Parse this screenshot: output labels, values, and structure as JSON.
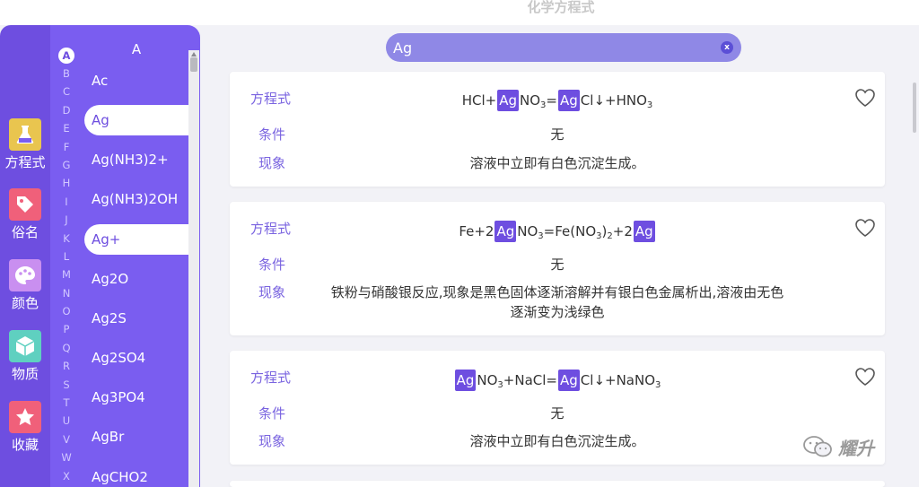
{
  "app": {
    "title": "化学方程式"
  },
  "categories": [
    {
      "label": "方程式",
      "icon": "flask-icon",
      "color": "#e9c54f"
    },
    {
      "label": "俗名",
      "icon": "tag-icon",
      "color": "#f0607a"
    },
    {
      "label": "颜色",
      "icon": "palette-icon",
      "color": "#c98ff0"
    },
    {
      "label": "物质",
      "icon": "cube-icon",
      "color": "#5fd0c0"
    },
    {
      "label": "收藏",
      "icon": "star-icon",
      "color": "#f0607a"
    }
  ],
  "alphabet": [
    "A",
    "B",
    "C",
    "D",
    "E",
    "F",
    "G",
    "H",
    "I",
    "J",
    "K",
    "L",
    "M",
    "N",
    "O",
    "P",
    "Q",
    "R",
    "S",
    "T",
    "U",
    "V",
    "W",
    "X"
  ],
  "alphabet_active": "A",
  "list": {
    "header": "A",
    "items": [
      "Ac",
      "Ag",
      "Ag(NH3)2+",
      "Ag(NH3)2OH",
      "Ag+",
      "Ag2O",
      "Ag2S",
      "Ag2SO4",
      "Ag3PO4",
      "AgBr",
      "AgCHO2"
    ],
    "selected": [
      "Ag",
      "Ag+"
    ]
  },
  "search": {
    "value": "Ag",
    "clear_label": "x"
  },
  "labels": {
    "equation": "方程式",
    "condition": "条件",
    "phenomenon": "现象"
  },
  "results": [
    {
      "eq": {
        "a": "HCl+",
        "b": "Ag",
        "c": "NO",
        "c_sub": "3",
        "d": "=",
        "e": "Ag",
        "f": "Cl↓+HNO",
        "f_sub": "3"
      },
      "condition": "无",
      "phenomenon": "溶液中立即有白色沉淀生成。"
    },
    {
      "eq": {
        "a": "Fe+2",
        "b": "Ag",
        "c": "NO",
        "c_sub": "3",
        "d": "=Fe(NO",
        "d_sub": "3",
        "e": ")",
        "e_sub": "2",
        "f": "+2",
        "g": "Ag"
      },
      "condition": "无",
      "phenomenon_line1": "铁粉与硝酸银反应,现象是黑色固体逐渐溶解并有银白色金属析出,溶液由无色",
      "phenomenon_line2": "逐渐变为浅绿色"
    },
    {
      "eq": {
        "a": "Ag",
        "b": "NO",
        "b_sub": "3",
        "c": "+NaCl=",
        "d": "Ag",
        "e": "Cl↓+NaNO",
        "e_sub": "3"
      },
      "condition": "无",
      "phenomenon": "溶液中立即有白色沉淀生成。"
    }
  ],
  "watermark": {
    "text": "耀升"
  },
  "colors": {
    "primary": "#6e4ee0",
    "panel": "#7a5df0",
    "search": "#8f88e6",
    "label": "#7a64e0"
  }
}
